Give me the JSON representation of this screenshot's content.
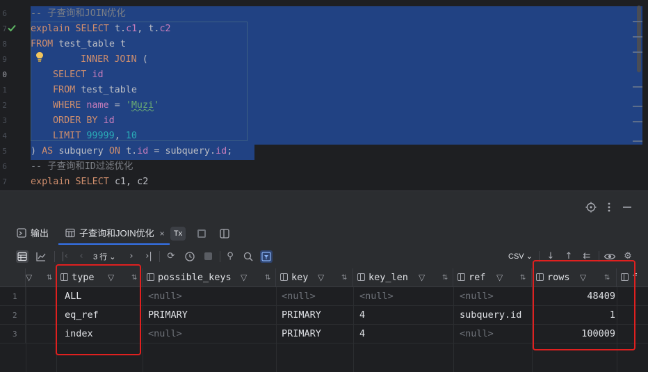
{
  "editor": {
    "gutter_lines": [
      "6",
      "7",
      "8",
      "9",
      "0",
      "1",
      "2",
      "3",
      "4",
      "5",
      "6",
      "7"
    ],
    "code": {
      "c1": "-- 子查询和JOIN优化",
      "l2": {
        "kw1": "explain SELECT ",
        "t1": "t.",
        "f1": "c1",
        "p1": ", ",
        "t2": "t.",
        "f2": "c2"
      },
      "l3": {
        "kw": "FROM ",
        "plain": "test_table t"
      },
      "l4": {
        "kw": "INNER JOIN ",
        "plain": "("
      },
      "l5": {
        "kw": "SELECT ",
        "f": "id"
      },
      "l6": {
        "kw": "FROM ",
        "plain": "test_table"
      },
      "l7": {
        "kw": "WHERE ",
        "f": "name",
        "op": " = ",
        "q1": "'",
        "str": "Muzi",
        "q2": "'"
      },
      "l8": {
        "kw": "ORDER BY ",
        "f": "id"
      },
      "l9": {
        "kw": "LIMIT ",
        "n1": "99999",
        "p": ", ",
        "n2": "10"
      },
      "l10": {
        "p1": ") ",
        "kw1": "AS ",
        "p2": "subquery ",
        "kw2": "ON ",
        "p3": "t.",
        "f1": "id",
        "p4": " = subquery.",
        "f2": "id",
        "p5": ";"
      },
      "c2": "-- 子查询和ID过滤优化",
      "l12": {
        "kw": "explain SELECT ",
        "plain": "c1, c2"
      }
    }
  },
  "tabs": {
    "output_label": "输出",
    "result_label": "子查询和JOIN优化",
    "close_glyph": "×",
    "tx_label": "Tx"
  },
  "toolbar": {
    "rows_label": "3 行",
    "export_format": "CSV"
  },
  "grid": {
    "columns": [
      "type",
      "possible_keys",
      "key",
      "key_len",
      "ref",
      "rows",
      "f"
    ],
    "rows": [
      {
        "n": "1",
        "type": "ALL",
        "possible_keys": "<null>",
        "key": "<null>",
        "key_len": "<null>",
        "ref": "<null>",
        "rows": "48409"
      },
      {
        "n": "2",
        "type": "eq_ref",
        "possible_keys": "PRIMARY",
        "key": "PRIMARY",
        "key_len": "4",
        "ref": "subquery.id",
        "rows": "1"
      },
      {
        "n": "3",
        "type": "index",
        "possible_keys": "<null>",
        "key": "PRIMARY",
        "key_len": "4",
        "ref": "<null>",
        "rows": "100009"
      }
    ]
  },
  "colors": {
    "selection": "#214283",
    "annotation": "#e0201f",
    "keyword": "#cf8e6d",
    "field": "#c77dbb",
    "number": "#2aacb8",
    "string": "#6aab73"
  }
}
